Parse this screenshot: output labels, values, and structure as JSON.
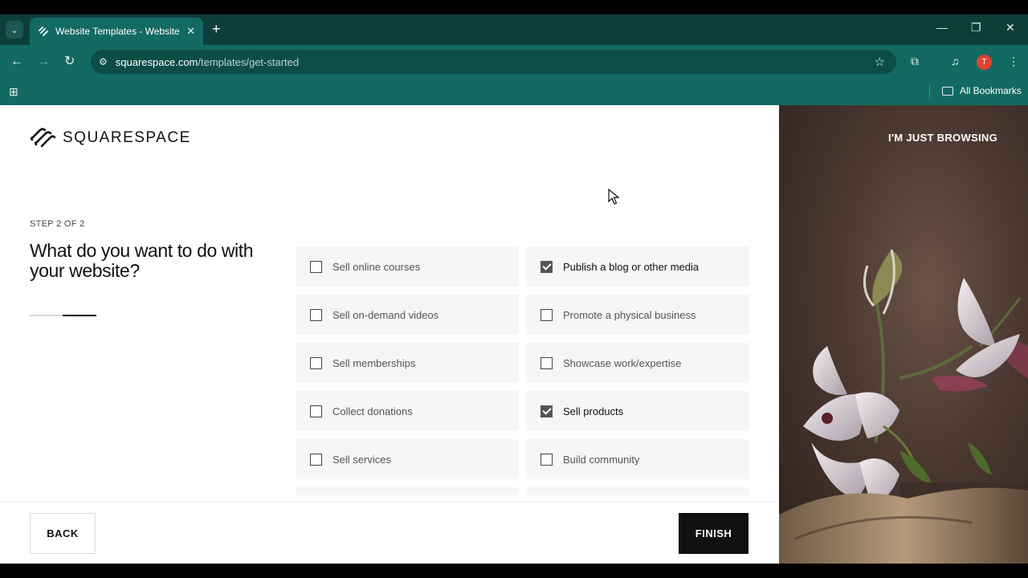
{
  "browser": {
    "tab_title": "Website Templates - Website D",
    "url_domain": "squarespace.com",
    "url_path": "/templates/get-started",
    "avatar_letter": "T",
    "bookmarks_label": "All Bookmarks"
  },
  "brand": {
    "wordmark": "SQUARESPACE"
  },
  "step": {
    "label": "STEP 2 OF 2",
    "progress": 0.5
  },
  "question": "What do you want to do with your website?",
  "options_left": [
    {
      "label": "Sell online courses",
      "checked": false
    },
    {
      "label": "Sell on-demand videos",
      "checked": false
    },
    {
      "label": "Sell memberships",
      "checked": false
    },
    {
      "label": "Collect donations",
      "checked": false
    },
    {
      "label": "Sell services",
      "checked": false
    }
  ],
  "options_right": [
    {
      "label": "Publish a blog or other media",
      "checked": true
    },
    {
      "label": "Promote a physical business",
      "checked": false
    },
    {
      "label": "Showcase work/expertise",
      "checked": false
    },
    {
      "label": "Sell products",
      "checked": true
    },
    {
      "label": "Build community",
      "checked": false
    }
  ],
  "buttons": {
    "back": "BACK",
    "finish": "FINISH"
  },
  "side_panel": {
    "link": "I'M JUST BROWSING"
  }
}
